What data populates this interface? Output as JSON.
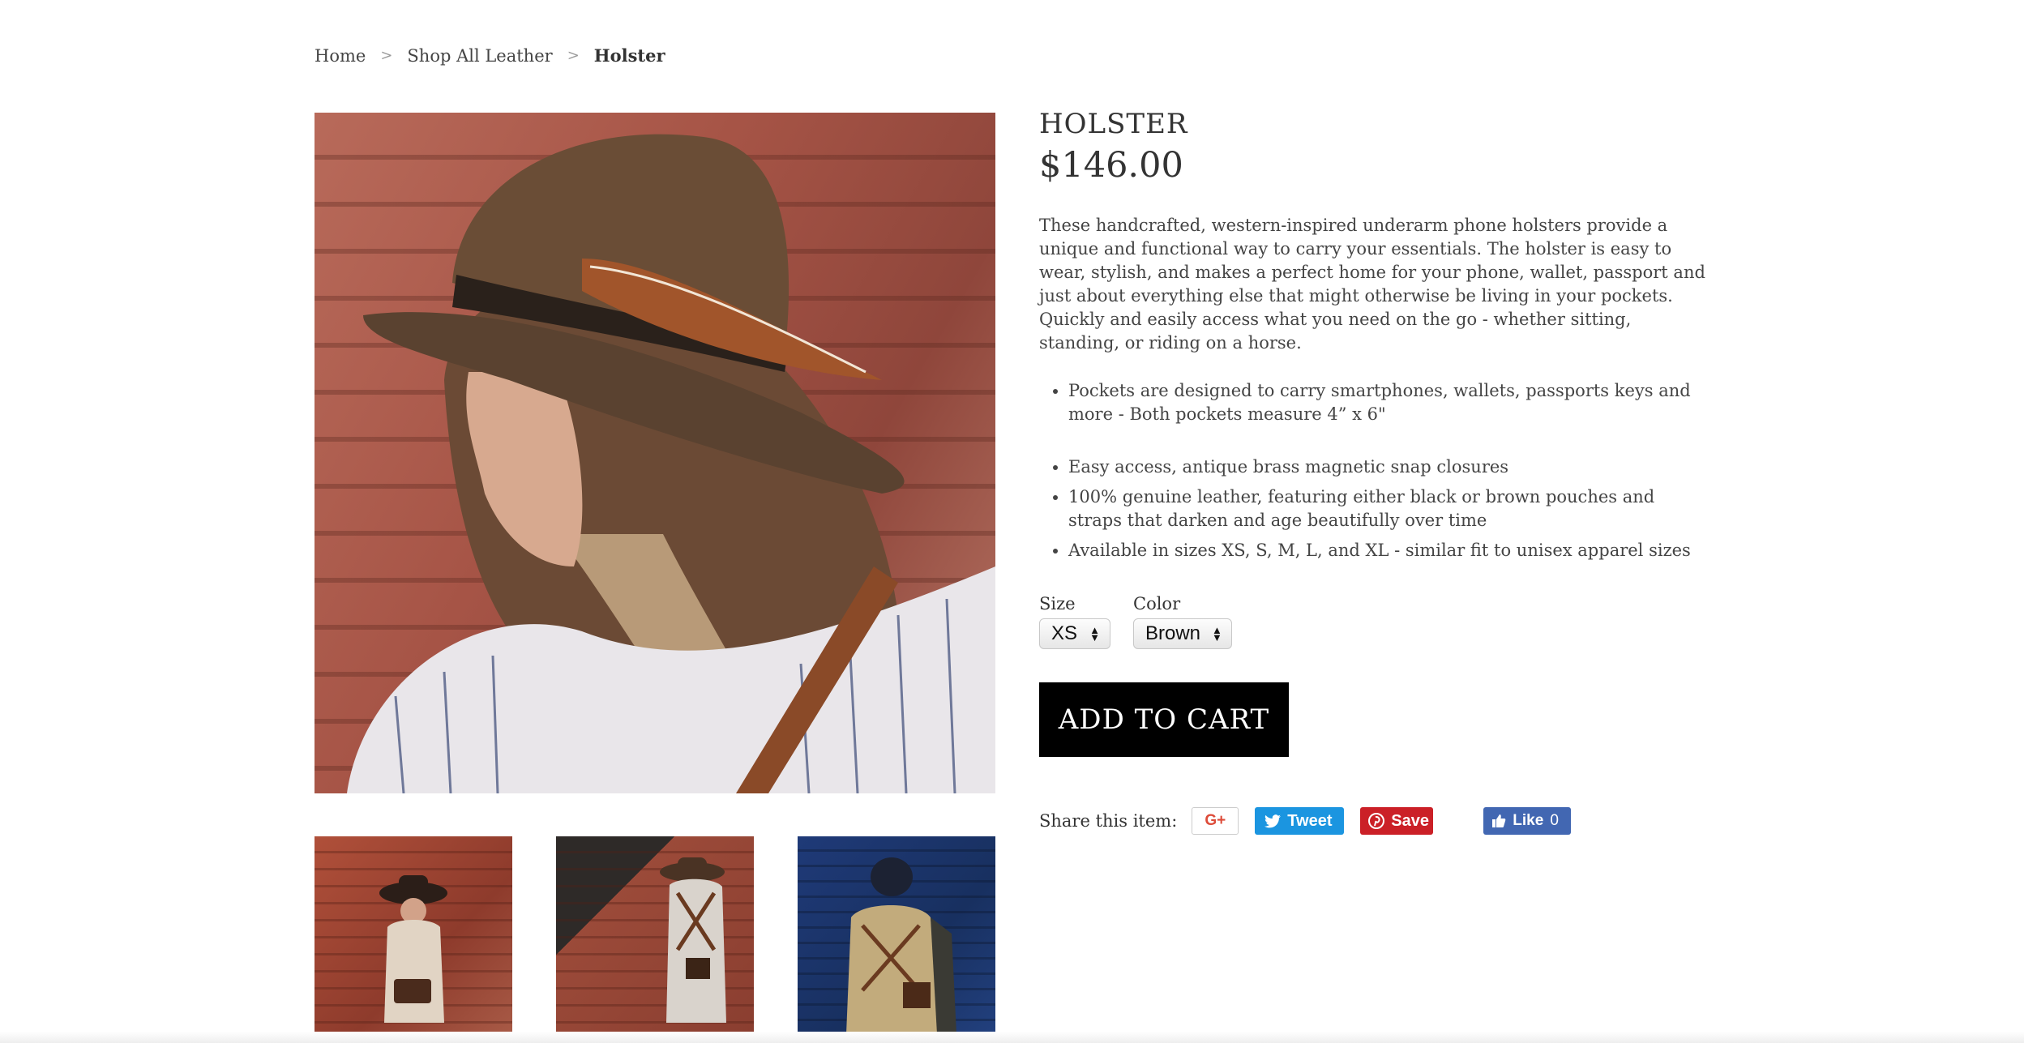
{
  "breadcrumb": {
    "home": "Home",
    "separator": ">",
    "category": "Shop All Leather",
    "current": "Holster"
  },
  "product": {
    "title": "HOLSTER",
    "price": "$146.00",
    "description": "These handcrafted, western-inspired underarm phone holsters provide a unique and functional way to carry your essentials. The holster is easy to wear, stylish, and makes a perfect home for your phone, wallet, passport and just about everything else that might otherwise be living in your pockets. Quickly and easily access what you need on the go - whether sitting, standing, or riding on a horse.",
    "features": [
      "Pockets are designed to carry smartphones, wallets, passports keys and more - Both pockets measure 4” x 6\"",
      "Easy access, antique brass magnetic snap closures",
      "100% genuine leather, featuring either black or brown pouches and straps that darken and age beautifully over time",
      "Available in sizes XS, S, M, L, and XL - similar fit to unisex apparel sizes"
    ]
  },
  "options": {
    "size_label": "Size",
    "size_value": "XS",
    "color_label": "Color",
    "color_value": "Brown"
  },
  "cart": {
    "add_label": "ADD TO CART"
  },
  "share": {
    "label": "Share this item:",
    "gplus": "G+",
    "tweet": "Tweet",
    "save": "Save",
    "like": "Like",
    "like_count": "0"
  },
  "colors": {
    "cart_button": "#000000",
    "twitter": "#1b95e0",
    "pinterest": "#cb2027",
    "facebook": "#4267b2",
    "gplus": "#dd4b39"
  }
}
